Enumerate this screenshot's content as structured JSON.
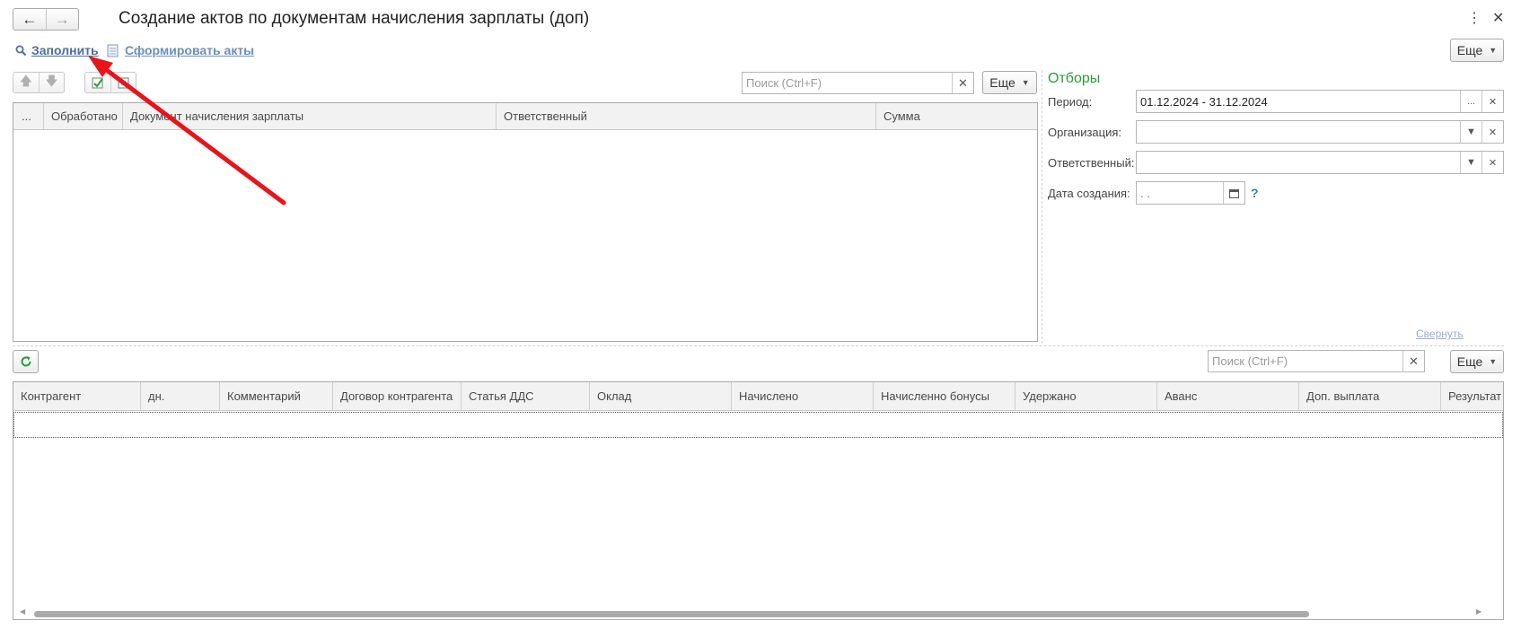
{
  "window": {
    "title": "Создание актов по документам начисления зарплаты (доп)"
  },
  "toolbar": {
    "fill_label": "Заполнить",
    "create_acts_label": "Сформировать акты",
    "more_label": "Еще"
  },
  "upper_list": {
    "search_placeholder": "Поиск (Ctrl+F)",
    "more_label": "Еще",
    "columns": [
      "...",
      "Обработано",
      "Документ начисления зарплаты",
      "Ответственный",
      "Сумма"
    ],
    "rows": []
  },
  "filters": {
    "title": "Отборы",
    "period_label": "Период:",
    "period_value": "01.12.2024 - 31.12.2024",
    "organization_label": "Организация:",
    "organization_value": "",
    "responsible_label": "Ответственный:",
    "responsible_value": "",
    "created_date_label": "Дата создания:",
    "created_date_value": " .  .",
    "help_mark": "?",
    "collapse_label": "Свернуть"
  },
  "lower_list": {
    "search_placeholder": "Поиск (Ctrl+F)",
    "more_label": "Еще",
    "columns": [
      "Контрагент",
      "дн.",
      "Комментарий",
      "Договор контрагента",
      "Статья ДДС",
      "Оклад",
      "Начислено",
      "Начисленно бонусы",
      "Удержано",
      "Аванс",
      "Доп. выплата",
      "Результат"
    ],
    "rows": []
  },
  "colors": {
    "filters_title": "#2a9a3a",
    "link": "#4a6fa0",
    "annotation_arrow": "#e8141a"
  }
}
